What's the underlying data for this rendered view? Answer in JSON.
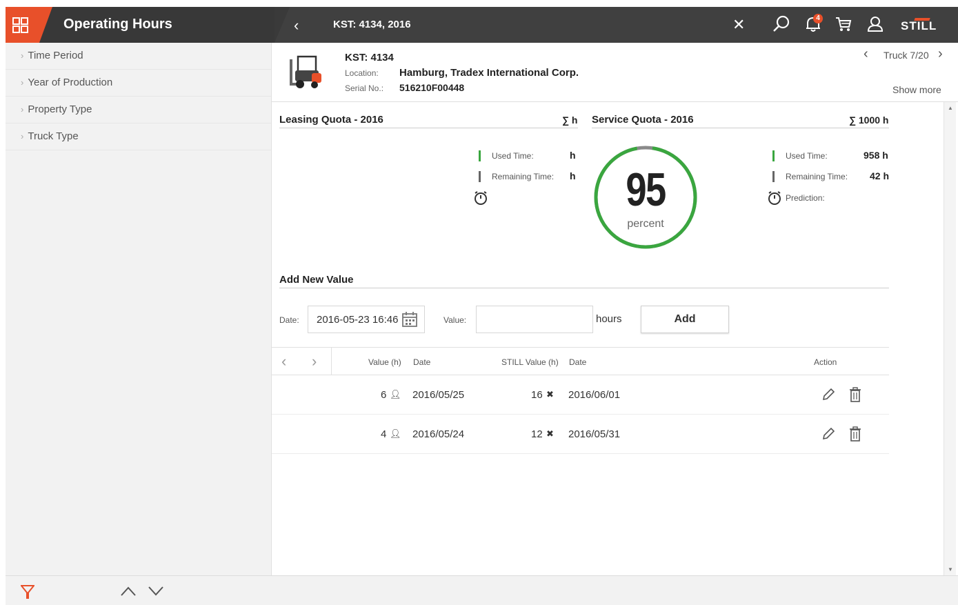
{
  "colors": {
    "accent": "#e8502a",
    "gauge_green": "#3aa63f",
    "used_green": "#3aa63f",
    "remaining_gray": "#666666"
  },
  "header": {
    "app_title": "Operating Hours",
    "breadcrumb": "KST: 4134, 2016",
    "notification_count": "4",
    "logo_text": "STILL",
    "icons": [
      "grid-icon",
      "back-arrow-icon",
      "close-icon",
      "search-icon",
      "bell-icon",
      "cart-icon",
      "user-icon"
    ]
  },
  "sidebar": {
    "filters": [
      {
        "label": "Time Period"
      },
      {
        "label": "Year of Production"
      },
      {
        "label": "Property Type"
      },
      {
        "label": "Truck Type"
      }
    ]
  },
  "truck": {
    "kst": "KST: 4134",
    "location_label": "Location:",
    "location": "Hamburg, Tradex International Corp.",
    "serial_label": "Serial No.:",
    "serial": "516210F00448",
    "nav_label": "Truck 7/20",
    "show_more": "Show more"
  },
  "leasing": {
    "title": "Leasing Quota - 2016",
    "sum": "∑ h",
    "used_label": "Used Time:",
    "used_value": "h",
    "remaining_label": "Remaining Time:",
    "remaining_value": "h"
  },
  "service": {
    "title": "Service Quota - 2016",
    "sum": "∑ 1000 h",
    "percent_value": 95,
    "percent_text": "95",
    "percent_unit": "percent",
    "used_label": "Used Time:",
    "used_value": "958 h",
    "remaining_label": "Remaining Time:",
    "remaining_value": "42 h",
    "prediction_label": "Prediction:"
  },
  "add_value": {
    "title": "Add New Value",
    "date_label": "Date:",
    "date_value": "2016-05-23 16:46",
    "value_label": "Value:",
    "value_input": "",
    "unit": "hours",
    "add_button": "Add"
  },
  "table": {
    "headers": [
      "Value (h)",
      "Date",
      "STILL Value (h)",
      "Date",
      "Action"
    ],
    "rows": [
      {
        "value": "6",
        "date": "2016/05/25",
        "still_value": "16",
        "still_date": "2016/06/01"
      },
      {
        "value": "4",
        "date": "2016/05/24",
        "still_value": "12",
        "still_date": "2016/05/31"
      }
    ]
  }
}
